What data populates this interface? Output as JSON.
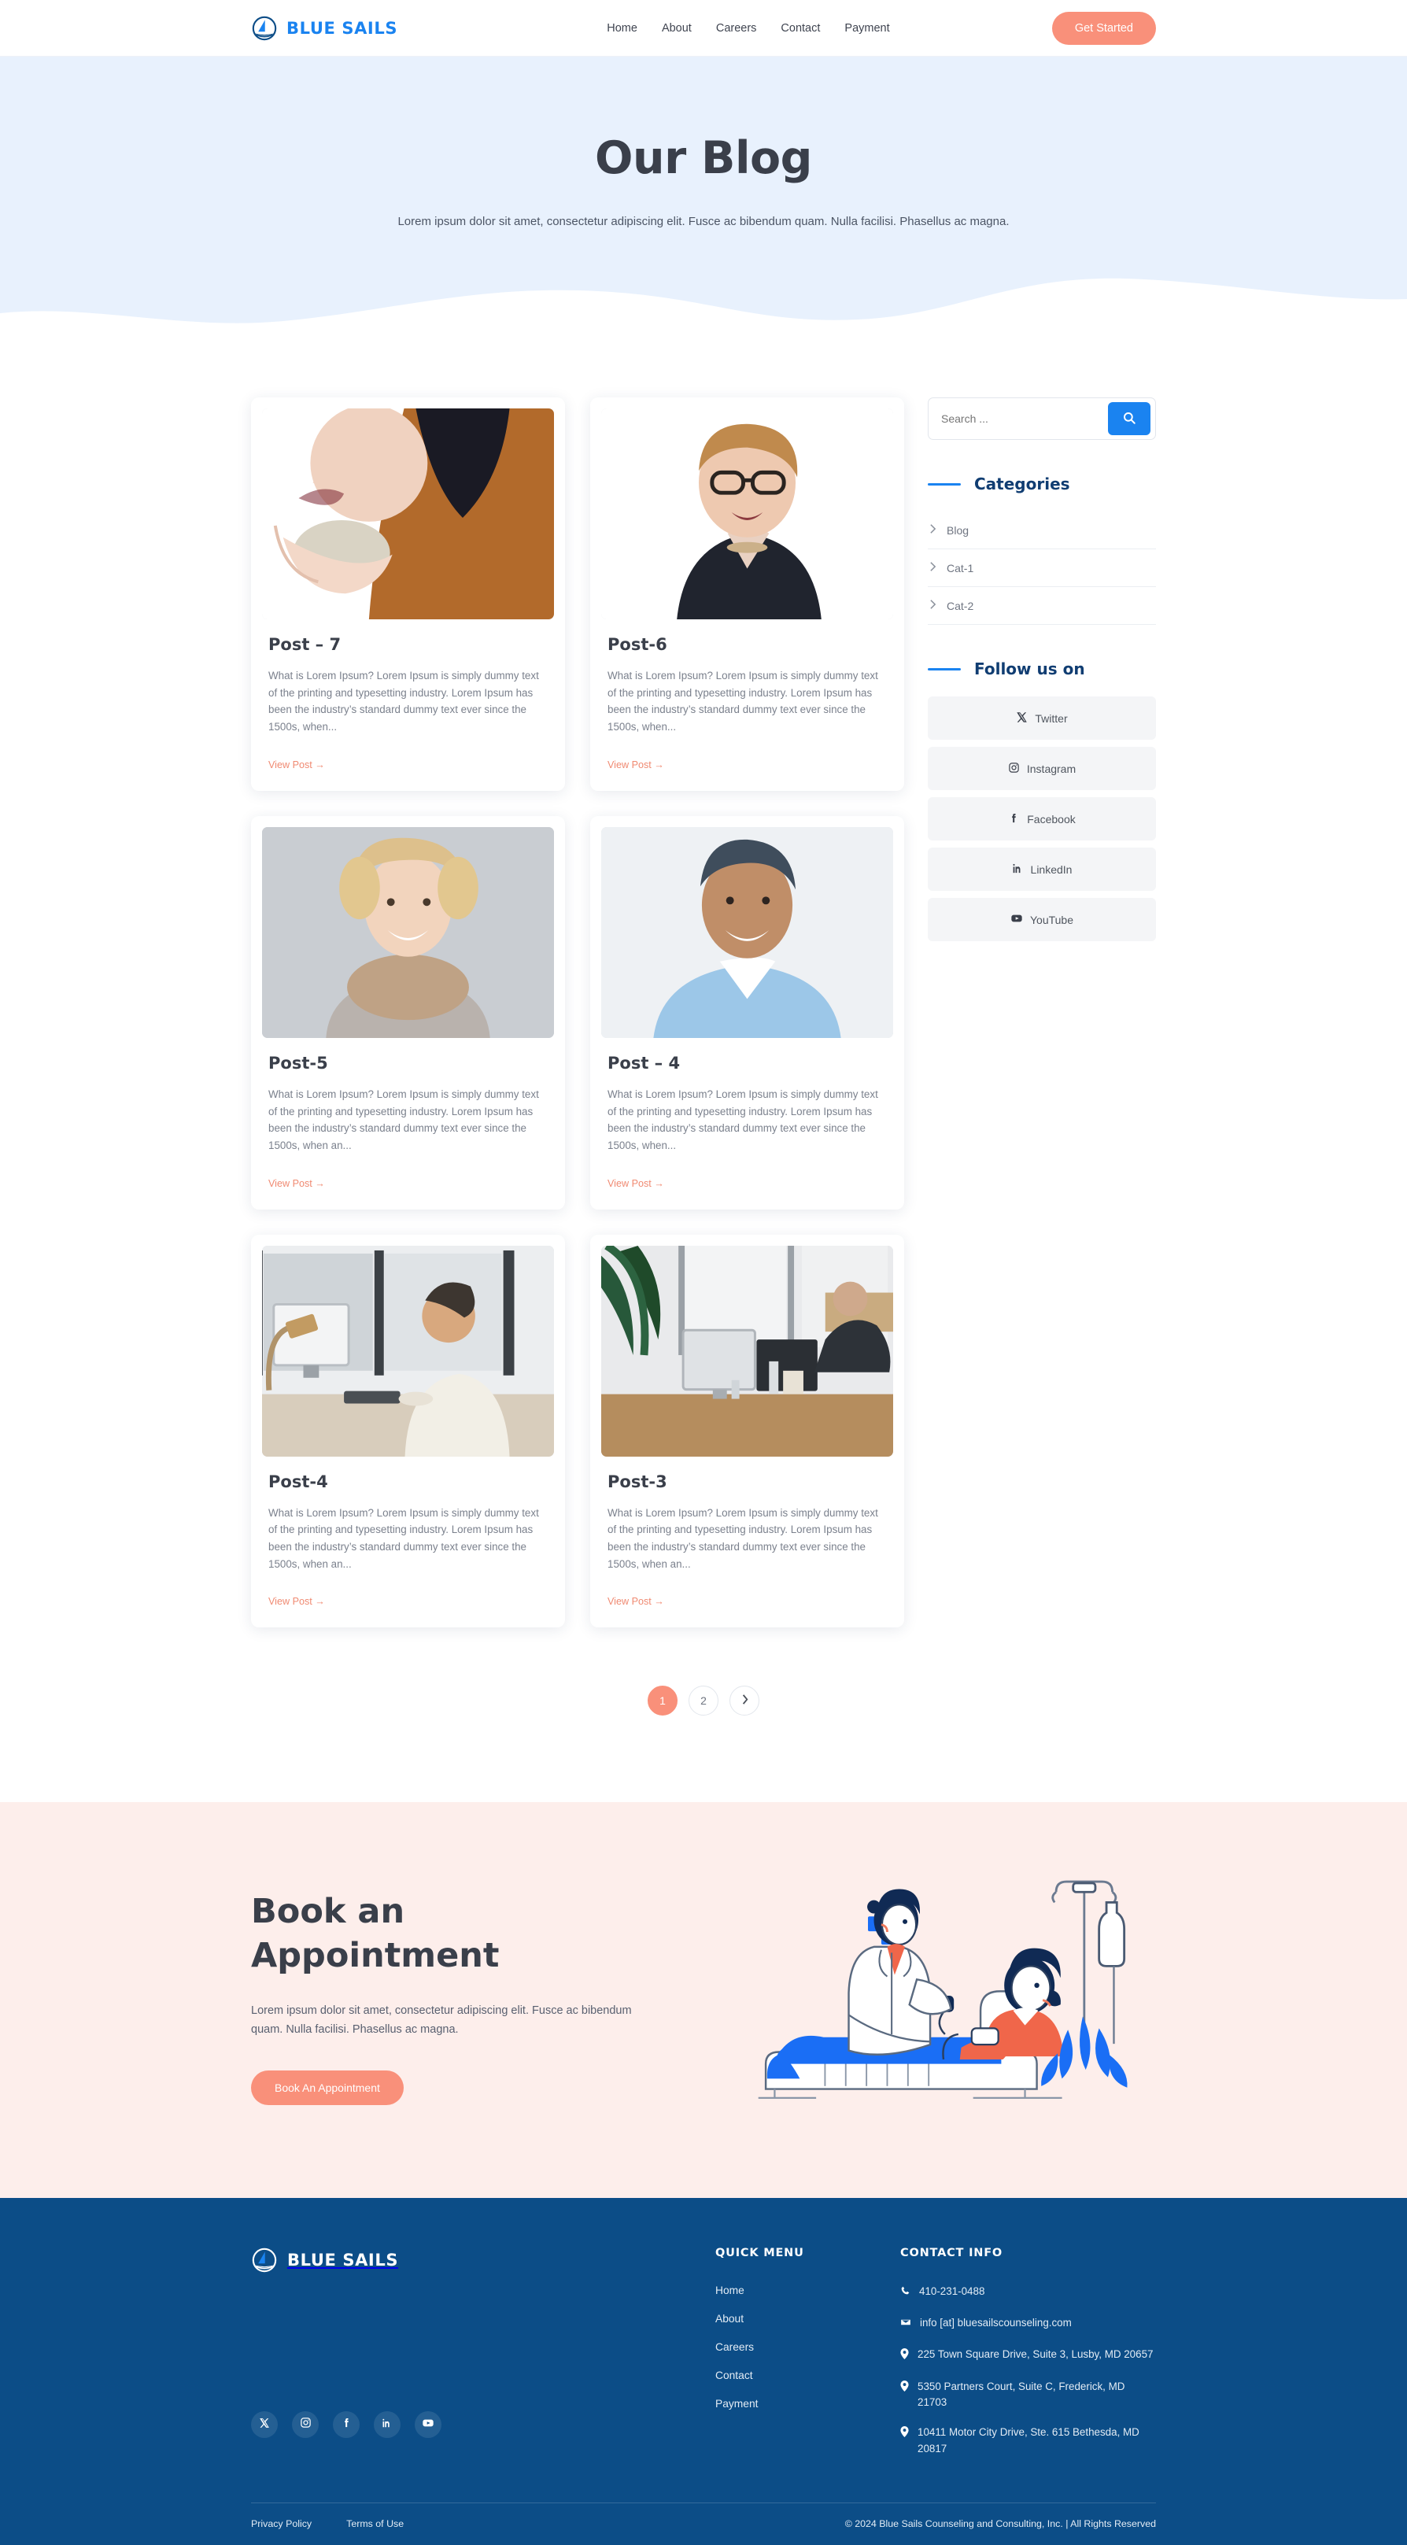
{
  "brand": {
    "name": "BLUE SAILS",
    "logo_icon": "sailboat-icon",
    "color": "#1a83f0"
  },
  "header": {
    "nav": [
      {
        "label": "Home"
      },
      {
        "label": "About"
      },
      {
        "label": "Careers"
      },
      {
        "label": "Contact"
      },
      {
        "label": "Payment"
      }
    ],
    "cta_label": "Get Started",
    "cta_color": "#f9907a"
  },
  "hero": {
    "title": "Our Blog",
    "subtitle": "Lorem ipsum dolor sit amet, consectetur adipiscing elit. Fusce ac bibendum quam. Nulla facilisi. Phasellus ac magna.",
    "background": "#e8f1fd"
  },
  "posts": [
    {
      "title": "Post – 7",
      "excerpt": "What is Lorem Ipsum? Lorem Ipsum is simply dummy text of the printing and typesetting industry. Lorem Ipsum has been the industry’s standard dummy text ever since the 1500s, when...",
      "link_label": "View Post →",
      "image_alt": "woman-with-coffee-cup-photo"
    },
    {
      "title": "Post-6",
      "excerpt": "What is Lorem Ipsum? Lorem Ipsum is simply dummy text of the printing and typesetting industry. Lorem Ipsum has been the industry’s standard dummy text ever since the 1500s, when...",
      "link_label": "View Post →",
      "image_alt": "woman-with-glasses-portrait-photo"
    },
    {
      "title": "Post-5",
      "excerpt": "What is Lorem Ipsum? Lorem Ipsum is simply dummy text of the printing and typesetting industry. Lorem Ipsum has been the industry’s standard dummy text ever since the 1500s, when an...",
      "link_label": "View Post →",
      "image_alt": "blonde-woman-with-scarf-photo"
    },
    {
      "title": "Post – 4",
      "excerpt": "What is Lorem Ipsum? Lorem Ipsum is simply dummy text of the printing and typesetting industry. Lorem Ipsum has been the industry’s standard dummy text ever since the 1500s, when...",
      "link_label": "View Post →",
      "image_alt": "smiling-man-blue-shirt-photo"
    },
    {
      "title": "Post-4",
      "excerpt": "What is Lorem Ipsum? Lorem Ipsum is simply dummy text of the printing and typesetting industry. Lorem Ipsum has been the industry’s standard dummy text ever since the 1500s, when an...",
      "link_label": "View Post →",
      "image_alt": "man-at-desk-office-photo"
    },
    {
      "title": "Post-3",
      "excerpt": "What is Lorem Ipsum? Lorem Ipsum is simply dummy text of the printing and typesetting industry. Lorem Ipsum has been the industry’s standard dummy text ever since the 1500s, when an...",
      "link_label": "View Post →",
      "image_alt": "open-plan-office-desks-photo"
    }
  ],
  "sidebar": {
    "search": {
      "placeholder": "Search ...",
      "button_icon": "search-icon",
      "button_color": "#1a83f0"
    },
    "categories": {
      "title": "Categories",
      "items": [
        {
          "label": "Blog"
        },
        {
          "label": "Cat-1"
        },
        {
          "label": "Cat-2"
        }
      ]
    },
    "follow": {
      "title": "Follow us on",
      "items": [
        {
          "label": "Twitter",
          "icon": "x-twitter-icon"
        },
        {
          "label": "Instagram",
          "icon": "instagram-icon"
        },
        {
          "label": "Facebook",
          "icon": "facebook-icon"
        },
        {
          "label": "LinkedIn",
          "icon": "linkedin-icon"
        },
        {
          "label": "YouTube",
          "icon": "youtube-icon"
        }
      ]
    }
  },
  "pagination": {
    "pages": [
      {
        "label": "1",
        "active": true
      },
      {
        "label": "2",
        "active": false
      }
    ],
    "next_icon": "chevron-right-icon"
  },
  "appointment": {
    "title_line1": "Book an",
    "title_line2": "Appointment",
    "text": "Lorem ipsum dolor sit amet, consectetur adipiscing elit. Fusce ac bibendum quam. Nulla facilisi. Phasellus ac magna.",
    "button_label": "Book An Appointment",
    "background": "#fdeeeb",
    "illustration_alt": "doctor-examining-patient-illustration"
  },
  "footer": {
    "background": "#0c4d87",
    "socials": [
      {
        "icon": "x-twitter-icon",
        "name": "Twitter"
      },
      {
        "icon": "instagram-icon",
        "name": "Instagram"
      },
      {
        "icon": "facebook-icon",
        "name": "Facebook"
      },
      {
        "icon": "linkedin-icon",
        "name": "LinkedIn"
      },
      {
        "icon": "youtube-icon",
        "name": "YouTube"
      }
    ],
    "quick_menu": {
      "title": "QUICK MENU",
      "items": [
        {
          "label": "Home"
        },
        {
          "label": "About"
        },
        {
          "label": "Careers"
        },
        {
          "label": "Contact"
        },
        {
          "label": "Payment"
        }
      ]
    },
    "contact": {
      "title": "CONTACT INFO",
      "items": [
        {
          "icon": "phone-icon",
          "text": "410-231-0488"
        },
        {
          "icon": "envelope-icon",
          "text": "info [at] bluesailscounseling.com"
        },
        {
          "icon": "map-pin-icon",
          "text": "225 Town Square Drive, Suite 3, Lusby, MD 20657"
        },
        {
          "icon": "map-pin-icon",
          "text": "5350 Partners Court, Suite C, Frederick, MD 21703"
        },
        {
          "icon": "map-pin-icon",
          "text": "10411 Motor City Drive, Ste. 615 Bethesda, MD 20817"
        }
      ]
    },
    "bar": {
      "privacy": "Privacy Policy",
      "terms": "Terms of Use",
      "copyright": "© 2024 Blue Sails Counseling and Consulting, Inc. | All Rights Reserved"
    }
  }
}
